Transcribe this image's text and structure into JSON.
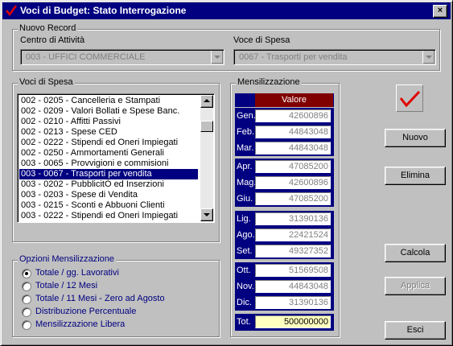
{
  "window": {
    "title": "Voci di Budget: Stato Interrogazione",
    "close_label": "×"
  },
  "nuovo_record": {
    "legend": "Nuovo Record",
    "centro_label": "Centro di Attività",
    "centro_value": "003  -  UFFICI COMMERCIALE",
    "voce_label": "Voce di Spesa",
    "voce_value": "0067  -  Trasporti per vendita"
  },
  "voci_di_spesa": {
    "legend": "Voci di Spesa",
    "items": [
      "002 - 0205 - Cancelleria e Stampati",
      "002 - 0209 - Valori Bollati e Spese Banc.",
      "002 - 0210 - Affitti Passivi",
      "002 - 0213 - Spese CED",
      "002 - 0222 - Stipendi ed Oneri Impiegati",
      "002 - 0250 - Ammortamenti Generali",
      "003 - 0065 - Provvigioni e commisioni",
      "003 - 0067 - Trasporti per vendita",
      "003 - 0202 - PubblicitÒ ed Inserzioni",
      "003 - 0203 - Spese di Vendita",
      "003 - 0215 - Sconti e Abbuoni Clienti",
      "003 - 0222 - Stipendi ed Oneri Impiegati"
    ],
    "selected_index": 7
  },
  "opzioni": {
    "legend": "Opzioni Mensilizzazione",
    "options": [
      "Totale / gg. Lavorativi",
      "Totale / 12 Mesi",
      "Totale / 11 Mesi -  Zero ad Agosto",
      "Distribuzione Percentuale",
      "Mensilizzazione Libera"
    ],
    "selected_index": 0
  },
  "mensilizzazione": {
    "legend": "Mensilizzazione",
    "header": "Valore",
    "months": [
      {
        "label": "Gen.",
        "value": "42600896"
      },
      {
        "label": "Feb.",
        "value": "44843048"
      },
      {
        "label": "Mar.",
        "value": "44843048"
      },
      {
        "label": "Apr.",
        "value": "47085200"
      },
      {
        "label": "Mag.",
        "value": "42600896"
      },
      {
        "label": "Giu.",
        "value": "47085200"
      },
      {
        "label": "Lig.",
        "value": "31390136"
      },
      {
        "label": "Ago.",
        "value": "22421524"
      },
      {
        "label": "Set.",
        "value": "49327352"
      },
      {
        "label": "Ott.",
        "value": "51569508"
      },
      {
        "label": "Nov.",
        "value": "44843048"
      },
      {
        "label": "Dic.",
        "value": "31390136"
      }
    ],
    "total_label": "Tot.",
    "total_value": "500000000"
  },
  "buttons": {
    "nuovo": "Nuovo",
    "elimina": "Elimina",
    "calcola": "Calcola",
    "applica": "Applica",
    "esci": "Esci"
  },
  "colors": {
    "titlebar": "#000080",
    "header": "#800000",
    "total_bg": "#ffffc0",
    "check": "#e00000"
  }
}
